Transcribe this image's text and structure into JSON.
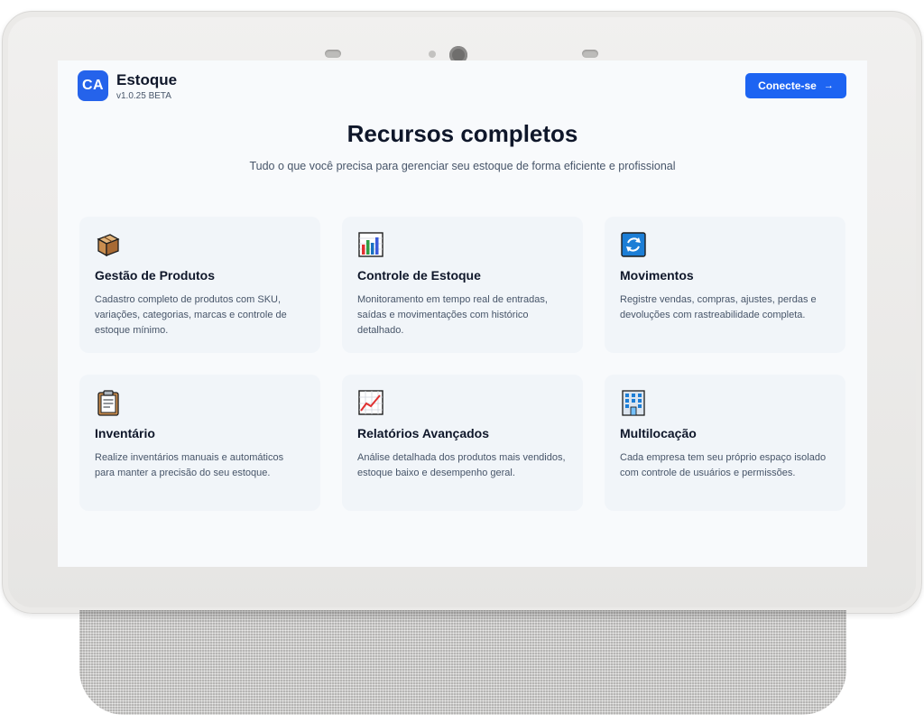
{
  "app": {
    "logo_text": "CA",
    "title": "Estoque",
    "version": "v1.0.25 BETA"
  },
  "header": {
    "connect_label": "Conecte-se",
    "connect_icon": "arrow-right-icon"
  },
  "section": {
    "title": "Recursos completos",
    "subtitle": "Tudo o que você precisa para gerenciar seu estoque de forma eficiente e profissional"
  },
  "features": [
    {
      "icon": "package-icon",
      "title": "Gestão de Produtos",
      "description": "Cadastro completo de produtos com SKU, variações, categorias, marcas e controle de estoque mínimo."
    },
    {
      "icon": "bar-chart-icon",
      "title": "Controle de Estoque",
      "description": "Monitoramento em tempo real de entradas, saídas e movimentações com histórico detalhado."
    },
    {
      "icon": "refresh-icon",
      "title": "Movimentos",
      "description": "Registre vendas, compras, ajustes, perdas e devoluções com rastreabilidade completa."
    },
    {
      "icon": "clipboard-icon",
      "title": "Inventário",
      "description": "Realize inventários manuais e automáticos para manter a precisão do seu estoque."
    },
    {
      "icon": "trend-chart-icon",
      "title": "Relatórios Avançados",
      "description": "Análise detalhada dos produtos mais vendidos, estoque baixo e desempenho geral."
    },
    {
      "icon": "office-building-icon",
      "title": "Multilocação",
      "description": "Cada empresa tem seu próprio espaço isolado com controle de usuários e permissões."
    }
  ],
  "colors": {
    "accent": "#2563eb",
    "button": "#1d64f2",
    "card_bg": "#f1f5f9",
    "screen_bg": "#f8fafc"
  }
}
